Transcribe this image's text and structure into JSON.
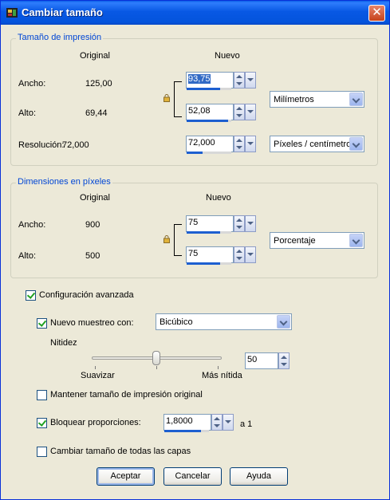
{
  "window": {
    "title": "Cambiar tamaño"
  },
  "print_size": {
    "legend": "Tamaño de impresión",
    "col_original": "Original",
    "col_new": "Nuevo",
    "width_label": "Ancho:",
    "height_label": "Alto:",
    "resolution_label": "Resolución:",
    "width_original": "125,00",
    "height_original": "69,44",
    "resolution_original": "72,000",
    "width_new": "93,75",
    "height_new": "52,08",
    "resolution_new": "72,000",
    "unit": "Milímetros",
    "resolution_unit": "Píxeles / centímetro"
  },
  "pixel_dims": {
    "legend": "Dimensiones en píxeles",
    "col_original": "Original",
    "col_new": "Nuevo",
    "width_label": "Ancho:",
    "height_label": "Alto:",
    "width_original": "900",
    "height_original": "500",
    "width_new": "75",
    "height_new": "75",
    "unit": "Porcentaje"
  },
  "advanced": {
    "label": "Configuración avanzada",
    "checked": true,
    "resample_label": "Nuevo muestreo con:",
    "resample_checked": true,
    "resample_method": "Bicúbico",
    "sharpness_label": "Nitidez",
    "sharpness_value": "50",
    "sharpness_level": 0.5,
    "soften_label": "Suavizar",
    "sharper_label": "Más nítida",
    "keep_print_label": "Mantener tamaño de impresión original",
    "keep_print_checked": false,
    "lock_ratio_label": "Bloquear proporciones:",
    "lock_ratio_checked": true,
    "ratio_value": "1,8000",
    "ratio_suffix": "a 1",
    "all_layers_label": "Cambiar tamaño de todas las capas",
    "all_layers_checked": false
  },
  "buttons": {
    "ok": "Aceptar",
    "cancel": "Cancelar",
    "help": "Ayuda"
  }
}
